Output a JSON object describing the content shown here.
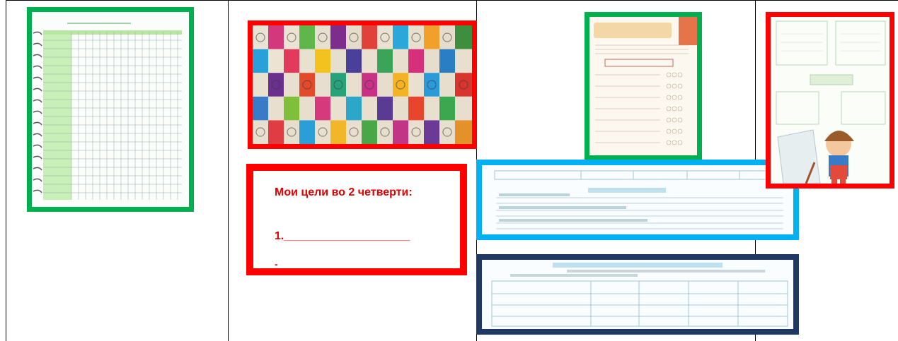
{
  "goals_card": {
    "title": "Мои цели во 2 четверти:",
    "line1": "1.____________________",
    "line2": "-"
  },
  "colors": {
    "green_frame": "#00b050",
    "red_frame": "#ff0000",
    "blue_frame": "#00b0f0",
    "navy_frame": "#1f3864"
  },
  "icons": {
    "tile_mosaic": "colored-letter-tiles",
    "mascot": "cartoon-girl-mascot"
  }
}
